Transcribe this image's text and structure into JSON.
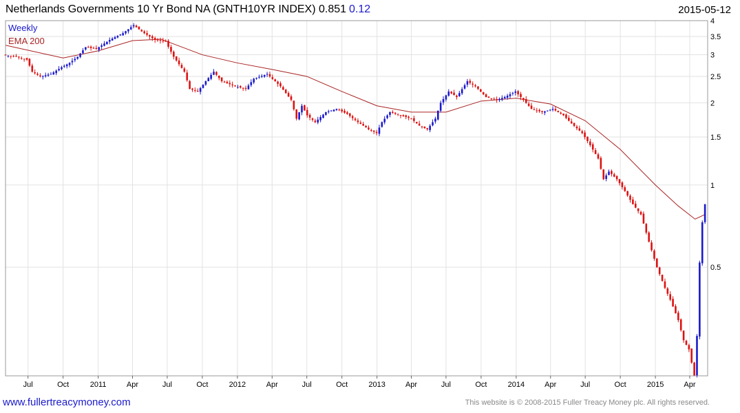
{
  "header": {
    "title": "Netherlands Governments 10 Yr Bond NA  (GNTH10YR INDEX) 0.851",
    "change": "0.12",
    "date": "2015-05-12"
  },
  "footer": {
    "link": "www.fullertreacymoney.com",
    "copyright": "This website is © 2008-2015 Fuller Treacy Money plc. All rights reserved."
  },
  "colors": {
    "up": "#1a1acc",
    "down": "#dd1111",
    "ema": "#aa2222",
    "legend_weekly": "#1a1acc",
    "legend_ema": "#aa2222"
  },
  "chart_data": {
    "type": "candlestick",
    "period": "Weekly",
    "scale": "log",
    "grid": true,
    "legend_position": "top-left",
    "series": [
      {
        "name": "Weekly"
      },
      {
        "name": "EMA 200"
      }
    ],
    "ylim": [
      0.2,
      4.0
    ],
    "y_ticks": [
      "4",
      "3.5",
      "3",
      "2.5",
      "2",
      "1.5",
      "1",
      "0.5"
    ],
    "x_tick_labels": [
      "Jul",
      "Oct",
      "2011",
      "Apr",
      "Jul",
      "Oct",
      "2012",
      "Apr",
      "Jul",
      "Oct",
      "2013",
      "Apr",
      "Jul",
      "Oct",
      "2014",
      "Apr",
      "Jul",
      "Oct",
      "2015",
      "Apr"
    ],
    "x_tick_dates": [
      "2010-07-01",
      "2010-10-01",
      "2011-01-01",
      "2011-04-01",
      "2011-07-01",
      "2011-10-01",
      "2012-01-01",
      "2012-04-01",
      "2012-07-01",
      "2012-10-01",
      "2013-01-01",
      "2013-04-01",
      "2013-07-01",
      "2013-10-01",
      "2014-01-01",
      "2014-04-01",
      "2014-07-01",
      "2014-10-01",
      "2015-01-01",
      "2015-04-01"
    ],
    "xlim": [
      "2010-05-03",
      "2015-05-18"
    ],
    "close_points": [
      [
        "2010-05-03",
        2.98
      ],
      [
        "2010-05-31",
        2.95
      ],
      [
        "2010-06-28",
        2.88
      ],
      [
        "2010-07-12",
        2.6
      ],
      [
        "2010-08-02",
        2.5
      ],
      [
        "2010-08-30",
        2.55
      ],
      [
        "2010-09-27",
        2.7
      ],
      [
        "2010-10-18",
        2.8
      ],
      [
        "2010-11-08",
        2.95
      ],
      [
        "2010-11-29",
        3.2
      ],
      [
        "2010-12-27",
        3.15
      ],
      [
        "2011-01-31",
        3.4
      ],
      [
        "2011-03-07",
        3.6
      ],
      [
        "2011-04-04",
        3.85
      ],
      [
        "2011-04-25",
        3.65
      ],
      [
        "2011-05-30",
        3.4
      ],
      [
        "2011-06-27",
        3.35
      ],
      [
        "2011-07-18",
        2.95
      ],
      [
        "2011-08-15",
        2.6
      ],
      [
        "2011-08-29",
        2.25
      ],
      [
        "2011-09-19",
        2.2
      ],
      [
        "2011-10-10",
        2.4
      ],
      [
        "2011-10-31",
        2.6
      ],
      [
        "2011-11-21",
        2.4
      ],
      [
        "2011-12-26",
        2.3
      ],
      [
        "2012-01-23",
        2.25
      ],
      [
        "2012-02-13",
        2.45
      ],
      [
        "2012-03-19",
        2.55
      ],
      [
        "2012-04-23",
        2.3
      ],
      [
        "2012-05-21",
        2.05
      ],
      [
        "2012-06-04",
        1.75
      ],
      [
        "2012-06-18",
        1.95
      ],
      [
        "2012-07-02",
        1.8
      ],
      [
        "2012-07-23",
        1.7
      ],
      [
        "2012-08-20",
        1.85
      ],
      [
        "2012-09-17",
        1.9
      ],
      [
        "2012-10-15",
        1.82
      ],
      [
        "2012-11-12",
        1.7
      ],
      [
        "2012-12-10",
        1.6
      ],
      [
        "2012-12-31",
        1.55
      ],
      [
        "2013-01-14",
        1.7
      ],
      [
        "2013-02-04",
        1.85
      ],
      [
        "2013-03-04",
        1.8
      ],
      [
        "2013-04-01",
        1.75
      ],
      [
        "2013-04-22",
        1.65
      ],
      [
        "2013-05-13",
        1.6
      ],
      [
        "2013-06-03",
        1.75
      ],
      [
        "2013-06-17",
        2.0
      ],
      [
        "2013-07-08",
        2.2
      ],
      [
        "2013-07-29",
        2.1
      ],
      [
        "2013-08-26",
        2.4
      ],
      [
        "2013-09-16",
        2.3
      ],
      [
        "2013-10-14",
        2.1
      ],
      [
        "2013-11-11",
        2.05
      ],
      [
        "2013-12-02",
        2.1
      ],
      [
        "2013-12-30",
        2.2
      ],
      [
        "2014-01-20",
        2.05
      ],
      [
        "2014-02-10",
        1.9
      ],
      [
        "2014-03-10",
        1.85
      ],
      [
        "2014-04-07",
        1.9
      ],
      [
        "2014-05-05",
        1.8
      ],
      [
        "2014-05-26",
        1.68
      ],
      [
        "2014-06-23",
        1.55
      ],
      [
        "2014-07-14",
        1.4
      ],
      [
        "2014-08-04",
        1.25
      ],
      [
        "2014-08-18",
        1.05
      ],
      [
        "2014-09-01",
        1.12
      ],
      [
        "2014-09-22",
        1.05
      ],
      [
        "2014-10-13",
        0.95
      ],
      [
        "2014-11-03",
        0.85
      ],
      [
        "2014-11-24",
        0.78
      ],
      [
        "2014-12-15",
        0.62
      ],
      [
        "2015-01-05",
        0.5
      ],
      [
        "2015-01-26",
        0.42
      ],
      [
        "2015-02-09",
        0.38
      ],
      [
        "2015-03-02",
        0.32
      ],
      [
        "2015-03-16",
        0.27
      ],
      [
        "2015-03-30",
        0.25
      ],
      [
        "2015-04-13",
        0.2
      ],
      [
        "2015-04-20",
        0.28
      ],
      [
        "2015-04-27",
        0.52
      ],
      [
        "2015-05-04",
        0.73
      ],
      [
        "2015-05-11",
        0.851
      ]
    ],
    "ema_points": [
      [
        "2010-05-03",
        3.25
      ],
      [
        "2010-10-01",
        2.92
      ],
      [
        "2011-01-01",
        3.1
      ],
      [
        "2011-04-01",
        3.38
      ],
      [
        "2011-06-15",
        3.42
      ],
      [
        "2011-10-01",
        3.0
      ],
      [
        "2012-01-01",
        2.8
      ],
      [
        "2012-04-01",
        2.65
      ],
      [
        "2012-07-01",
        2.5
      ],
      [
        "2012-10-01",
        2.2
      ],
      [
        "2013-01-01",
        1.95
      ],
      [
        "2013-04-01",
        1.85
      ],
      [
        "2013-07-01",
        1.85
      ],
      [
        "2013-10-01",
        2.03
      ],
      [
        "2014-01-01",
        2.08
      ],
      [
        "2014-04-01",
        1.98
      ],
      [
        "2014-07-01",
        1.72
      ],
      [
        "2014-10-01",
        1.35
      ],
      [
        "2015-01-01",
        1.0
      ],
      [
        "2015-03-01",
        0.84
      ],
      [
        "2015-04-15",
        0.75
      ],
      [
        "2015-05-11",
        0.78
      ]
    ]
  }
}
